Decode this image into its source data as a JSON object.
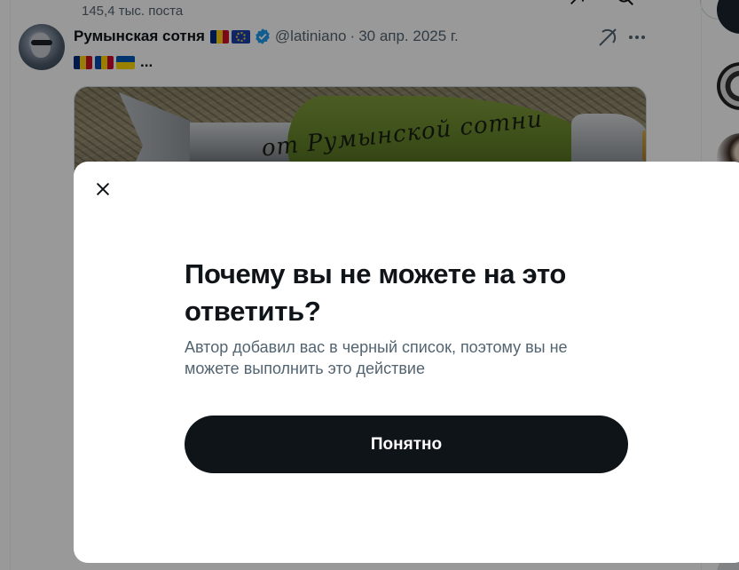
{
  "header": {
    "post_count": "145,4 тыс. поста"
  },
  "tweet": {
    "author_name": "Румынская сотня",
    "handle": "@latiniano",
    "separator": "·",
    "date": "30 апр. 2025 г.",
    "sub_text": "...",
    "image_text": "от Румынской сотни"
  },
  "modal": {
    "title": "Почему вы не можете на это ответить?",
    "description": "Автор добавил вас в черный список, поэтому вы не можете выполнить это действие",
    "ok_label": "Понятно"
  },
  "colors": {
    "primary_text": "#0f1419",
    "secondary_text": "#536471",
    "verified_blue": "#1d9bf0",
    "button_bg": "#0f1419",
    "overlay": "rgba(0,0,0,0.4)"
  },
  "icons": [
    "back-icon",
    "grok-icon",
    "search-icon",
    "verified-icon",
    "more-icon",
    "close-icon"
  ]
}
